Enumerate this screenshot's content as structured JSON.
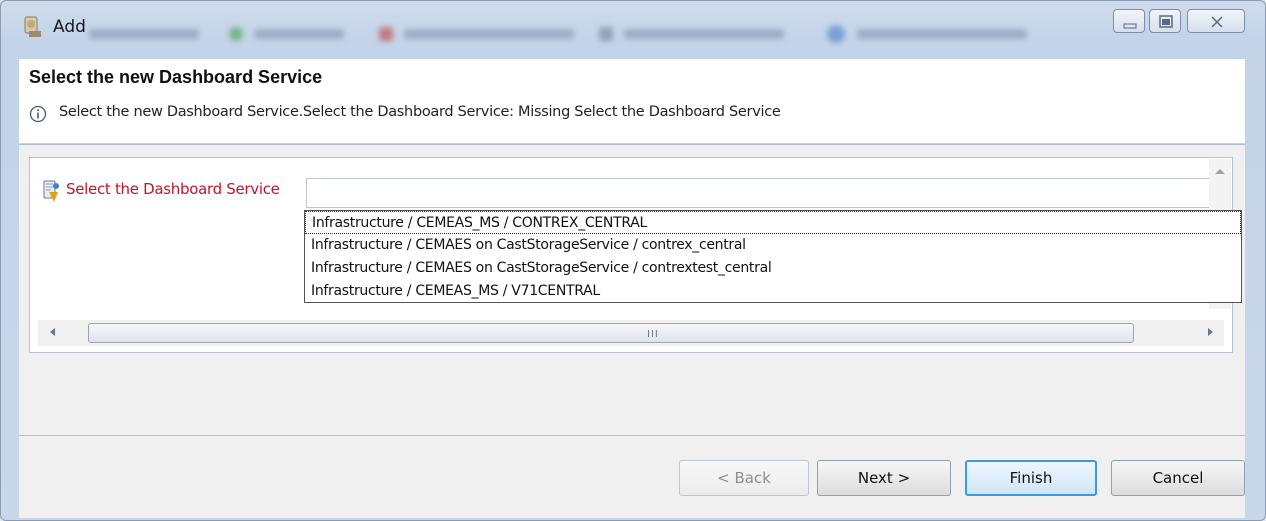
{
  "window": {
    "title": "Add"
  },
  "header": {
    "title": "Select the new Dashboard Service",
    "info_message": "Select the new Dashboard Service.Select the Dashboard Service: Missing Select the Dashboard Service"
  },
  "form": {
    "field_label": "Select the Dashboard Service",
    "field_value": "",
    "dropdown_options": [
      "Infrastructure / CEMEAS_MS / CONTREX_CENTRAL",
      "Infrastructure / CEMAES on CastStorageService / contrex_central",
      "Infrastructure / CEMAES on CastStorageService / contrextest_central",
      "Infrastructure / CEMEAS_MS / V71CENTRAL"
    ],
    "scroll_grip": "III"
  },
  "footer": {
    "back_label": "< Back",
    "next_label": "Next >",
    "finish_label": "Finish",
    "cancel_label": "Cancel"
  },
  "colors": {
    "error_label": "#c0152b",
    "default_button_border": "#3c9be0",
    "window_frame": "#c9d7ea"
  }
}
